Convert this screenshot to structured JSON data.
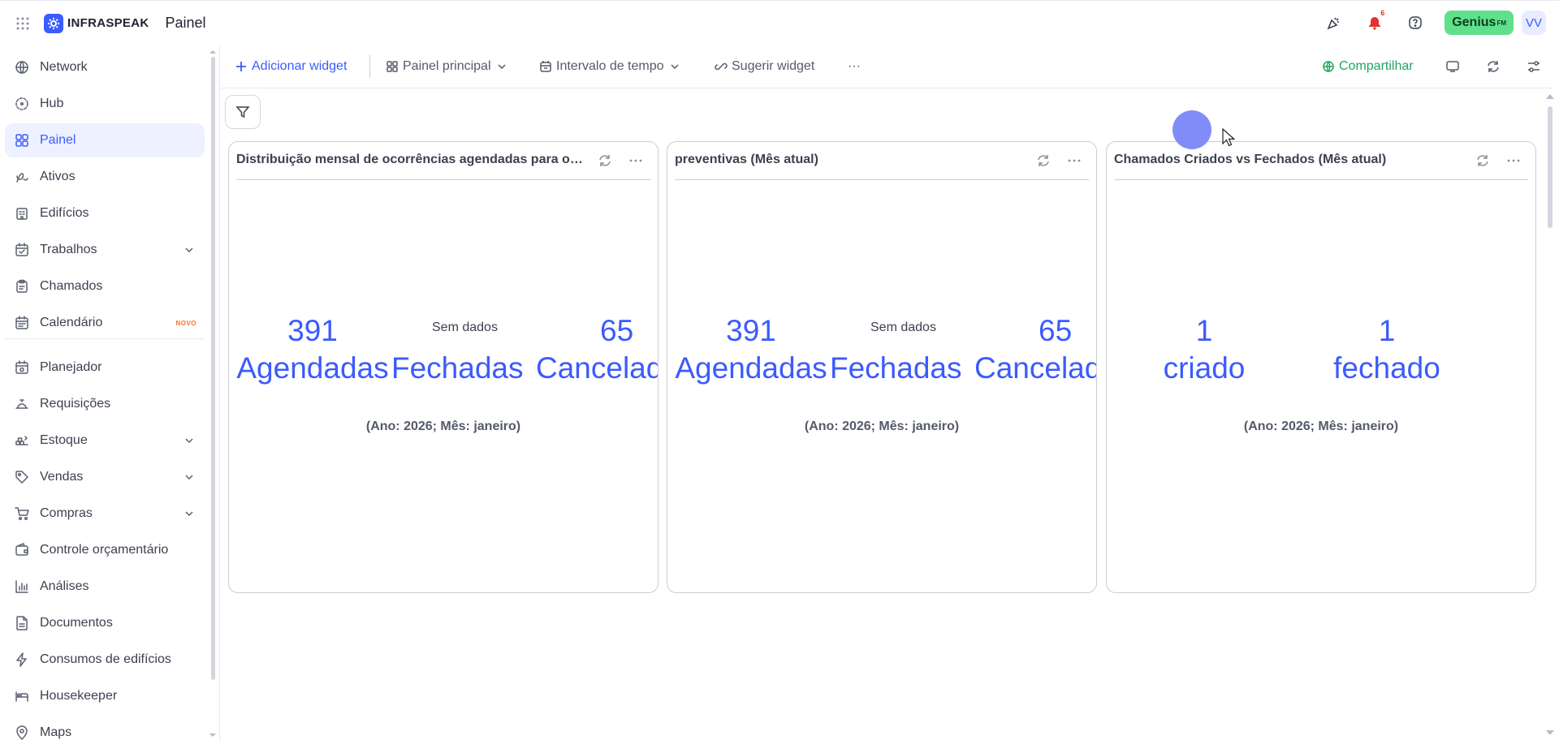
{
  "app": {
    "brand": "INFRASPEAK",
    "page_title": "Painel"
  },
  "topbar": {
    "notification_count": "6",
    "genius_label": "Genius",
    "genius_suffix": "FM",
    "avatar_initials": "VV"
  },
  "sidebar": {
    "items": [
      {
        "label": "Network",
        "icon": "network-icon"
      },
      {
        "label": "Hub",
        "icon": "hub-icon"
      },
      {
        "label": "Painel",
        "icon": "dashboard-icon",
        "active": true
      },
      {
        "label": "Ativos",
        "icon": "assets-icon"
      },
      {
        "label": "Edifícios",
        "icon": "building-icon"
      },
      {
        "label": "Trabalhos",
        "icon": "calendar-check-icon",
        "expandable": true
      },
      {
        "label": "Chamados",
        "icon": "clipboard-icon"
      },
      {
        "label": "Calendário",
        "icon": "calendar-icon",
        "badge": "NOVO"
      },
      {
        "label": "Planejador",
        "icon": "planner-icon"
      },
      {
        "label": "Requisições",
        "icon": "bell-service-icon"
      },
      {
        "label": "Estoque",
        "icon": "stock-icon",
        "expandable": true
      },
      {
        "label": "Vendas",
        "icon": "tag-icon",
        "expandable": true
      },
      {
        "label": "Compras",
        "icon": "cart-icon",
        "expandable": true
      },
      {
        "label": "Controle orçamentário",
        "icon": "wallet-icon"
      },
      {
        "label": "Análises",
        "icon": "chart-icon"
      },
      {
        "label": "Documentos",
        "icon": "document-icon"
      },
      {
        "label": "Consumos de edifícios",
        "icon": "lightning-icon"
      },
      {
        "label": "Housekeeper",
        "icon": "bed-icon"
      },
      {
        "label": "Maps",
        "icon": "map-pin-icon"
      }
    ]
  },
  "toolbar": {
    "add_widget": "Adicionar widget",
    "main_panel": "Painel principal",
    "time_interval": "Intervalo de tempo",
    "suggest_widget": "Sugerir widget",
    "more": "···",
    "share": "Compartilhar"
  },
  "cards": [
    {
      "title": "Distribuição mensal de ocorrências agendadas para o i...",
      "metrics": [
        {
          "value": "391",
          "label": "Agendadas"
        },
        {
          "value": "",
          "label": "Fechadas"
        },
        {
          "value": "65",
          "label": "Cancelad"
        }
      ],
      "nodata": "Sem dados",
      "period": "(Ano: 2026; Mês: janeiro)"
    },
    {
      "title": "preventivas (Mês atual)",
      "metrics": [
        {
          "value": "391",
          "label": "Agendadas"
        },
        {
          "value": "",
          "label": "Fechadas"
        },
        {
          "value": "65",
          "label": "Cancelad"
        }
      ],
      "nodata": "Sem dados",
      "period": "(Ano: 2026; Mês: janeiro)"
    },
    {
      "title": "Chamados Criados vs Fechados (Mês atual)",
      "metrics": [
        {
          "value": "1",
          "label": "criado"
        },
        {
          "value": "1",
          "label": "fechado"
        }
      ],
      "period": "(Ano: 2026; Mês: janeiro)"
    }
  ],
  "colors": {
    "accent": "#3b5bfd",
    "share": "#22a55b",
    "genius": "#5fe08a",
    "novo": "#f0752b",
    "notification": "#e5322e"
  }
}
